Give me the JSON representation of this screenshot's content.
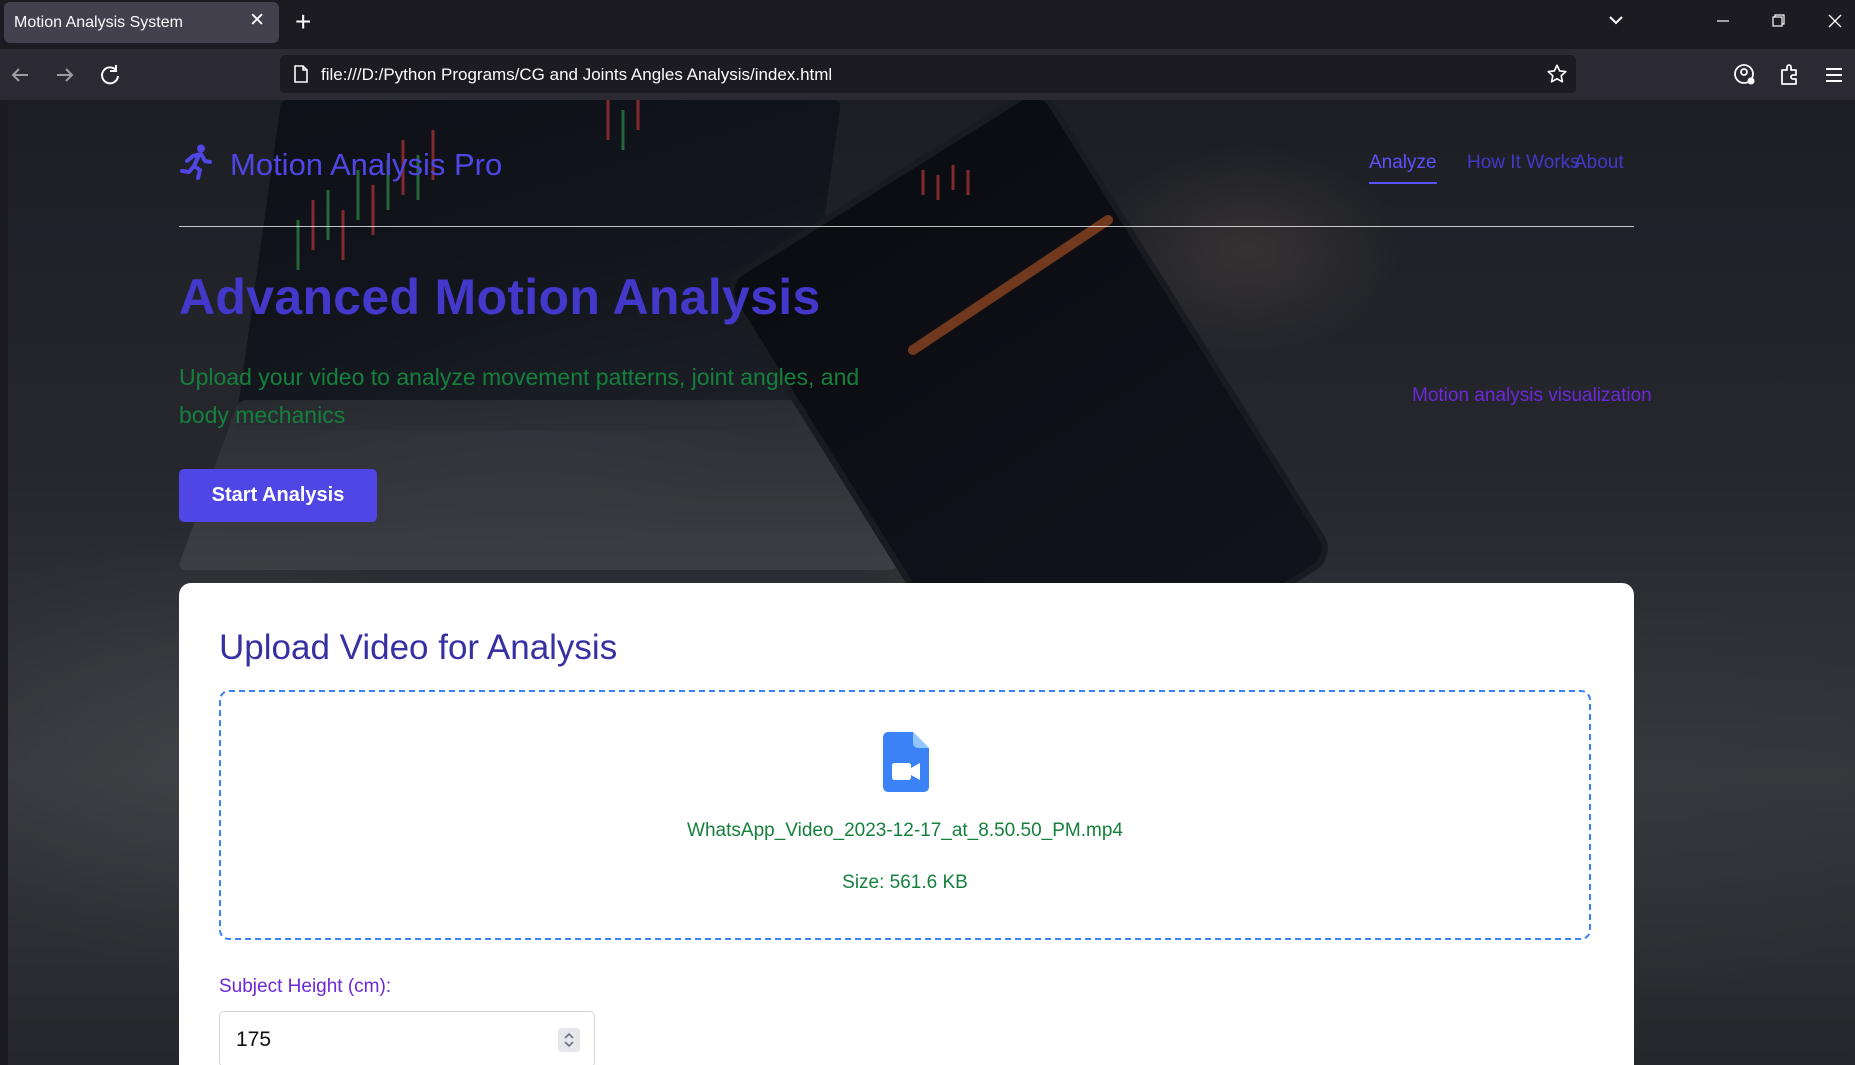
{
  "browser": {
    "tab_title": "Motion Analysis System",
    "url": "file:///D:/Python Programs/CG and Joints Angles Analysis/index.html"
  },
  "header": {
    "brand": "Motion Analysis Pro",
    "nav": [
      "Analyze",
      "How It Works",
      "About"
    ],
    "active_nav": "Analyze"
  },
  "hero": {
    "title": "Advanced Motion Analysis",
    "subtitle": "Upload your video to analyze movement patterns, joint angles, and body mechanics",
    "image_alt": "Motion analysis visualization",
    "cta": "Start Analysis"
  },
  "upload": {
    "title": "Upload Video for Analysis",
    "file_name": "WhatsApp_Video_2023-12-17_at_8.50.50_PM.mp4",
    "file_size": "Size: 561.6 KB",
    "height_label": "Subject Height (cm):",
    "height_value": "175"
  },
  "icons": {
    "logo": "running-person-icon",
    "file": "video-file-icon"
  },
  "colors": {
    "primary": "#4f46e5",
    "heading": "#3730a3",
    "success_text": "#15803d",
    "accent_purple": "#6d28d9",
    "dropzone_border": "#3b82f6"
  }
}
